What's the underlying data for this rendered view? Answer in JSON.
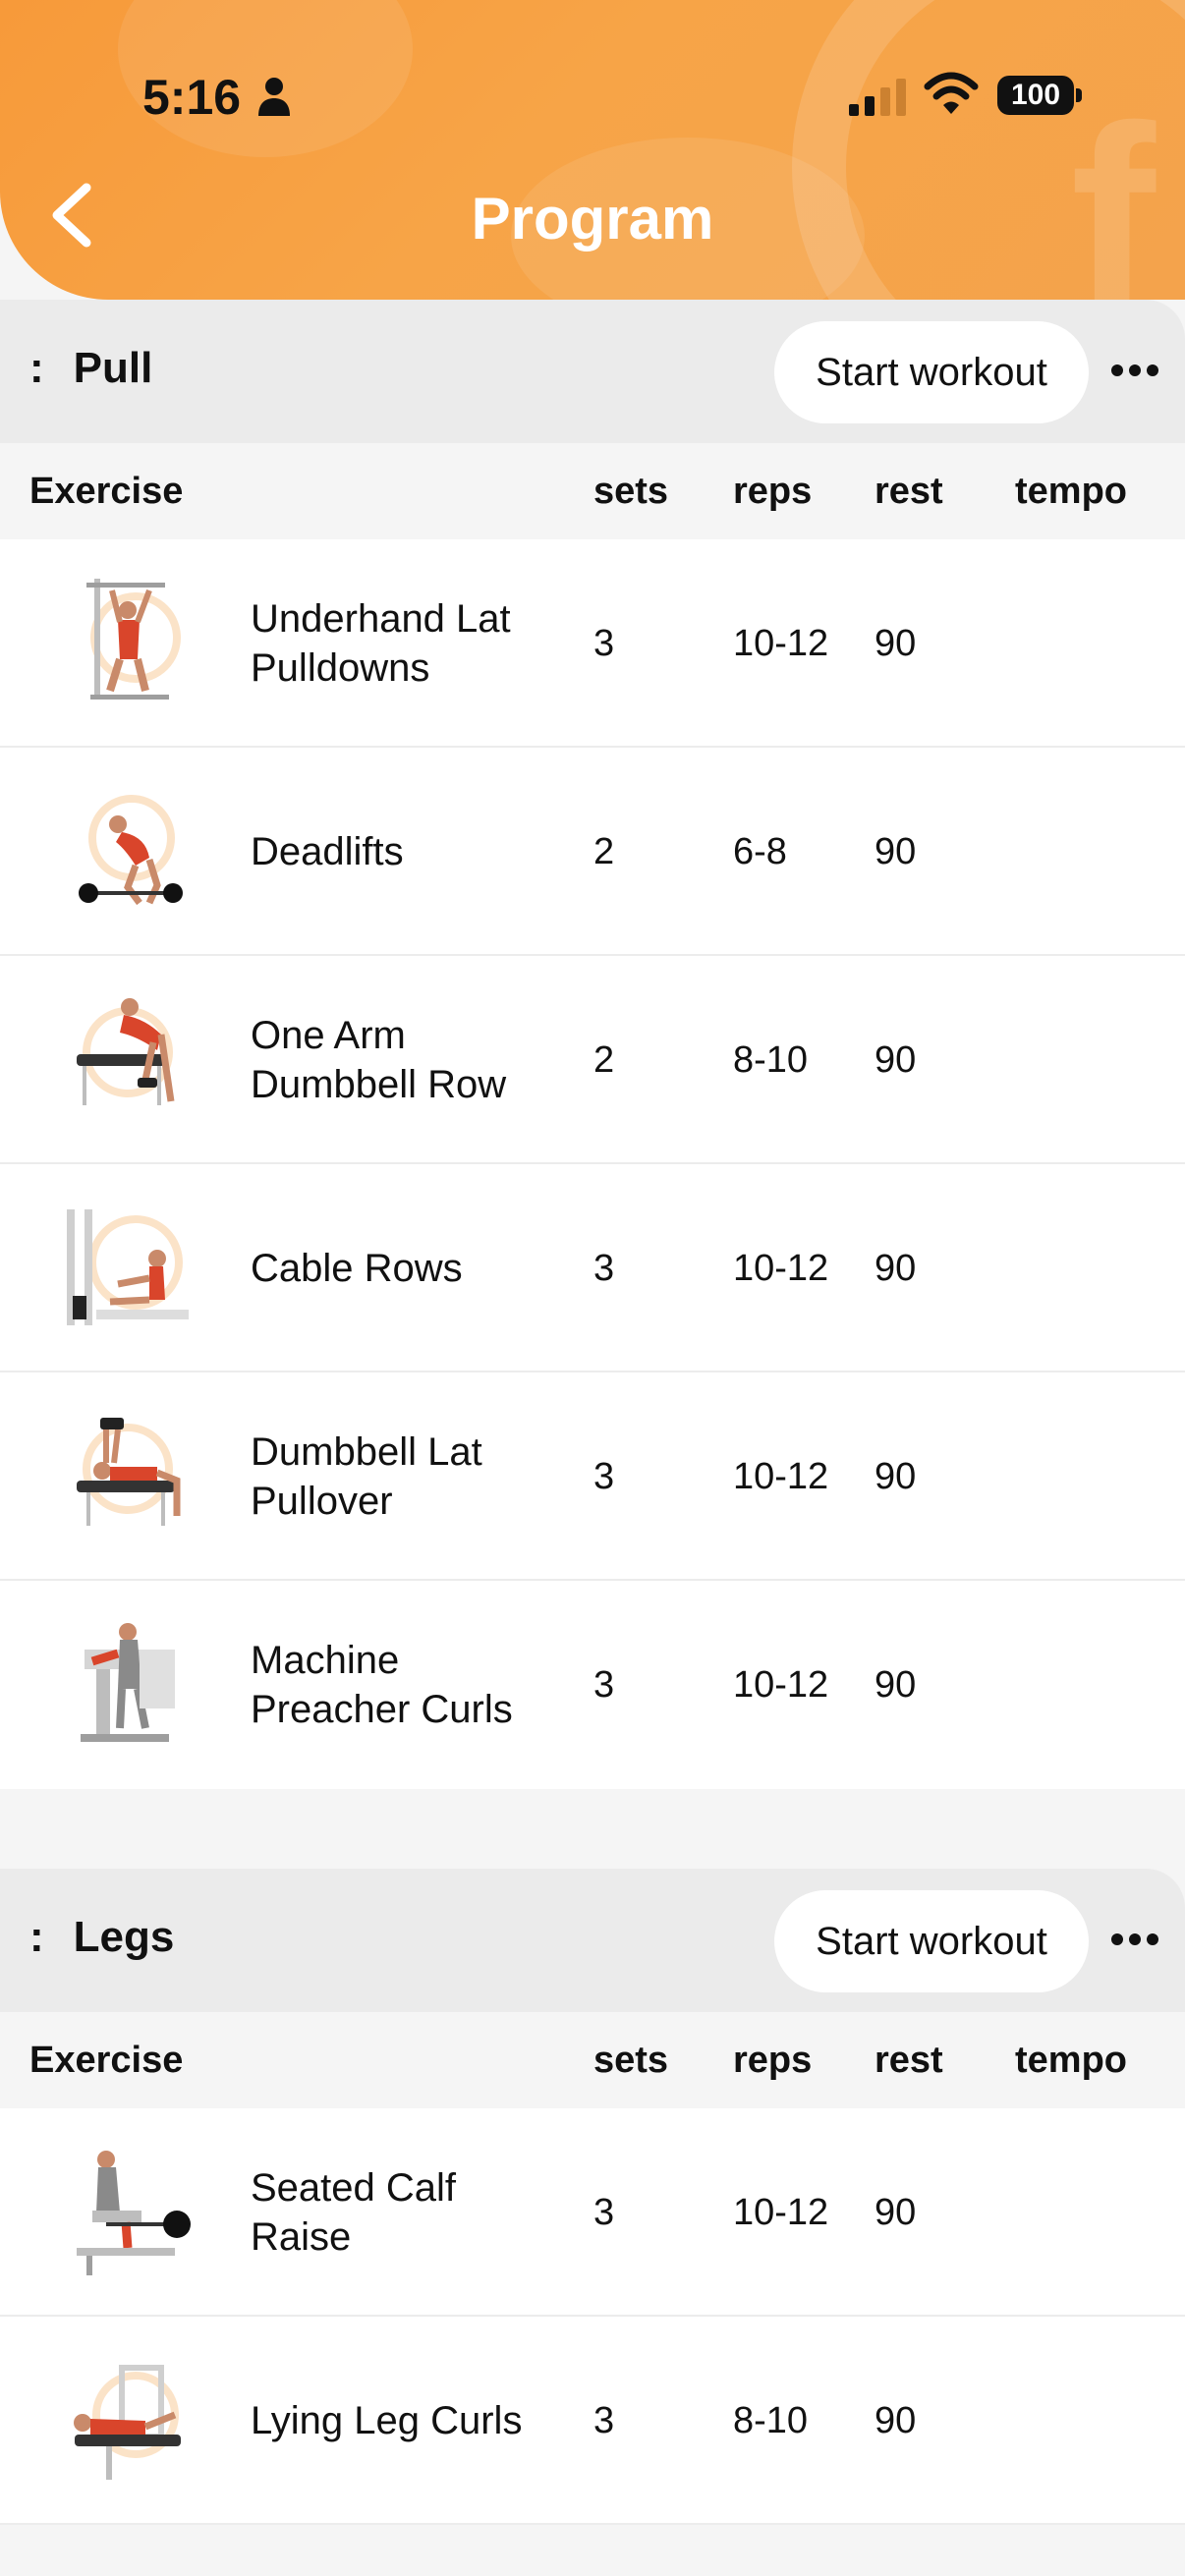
{
  "status_bar": {
    "time": "5:16",
    "battery": "100"
  },
  "header": {
    "title": "Program"
  },
  "columns": {
    "exercise": "Exercise",
    "sets": "sets",
    "reps": "reps",
    "rest": "rest",
    "tempo": "tempo"
  },
  "sections": [
    {
      "prefix": ":",
      "name": "Pull",
      "start_label": "Start workout",
      "exercises": [
        {
          "name": "Underhand Lat Pulldowns",
          "sets": "3",
          "reps": "10-12",
          "rest": "90",
          "tempo": ""
        },
        {
          "name": "Deadlifts",
          "sets": "2",
          "reps": "6-8",
          "rest": "90",
          "tempo": ""
        },
        {
          "name": "One Arm Dumbbell Row",
          "sets": "2",
          "reps": "8-10",
          "rest": "90",
          "tempo": ""
        },
        {
          "name": "Cable Rows",
          "sets": "3",
          "reps": "10-12",
          "rest": "90",
          "tempo": ""
        },
        {
          "name": "Dumbbell Lat Pullover",
          "sets": "3",
          "reps": "10-12",
          "rest": "90",
          "tempo": ""
        },
        {
          "name": "Machine Preacher Curls",
          "sets": "3",
          "reps": "10-12",
          "rest": "90",
          "tempo": ""
        }
      ]
    },
    {
      "prefix": ":",
      "name": "Legs",
      "start_label": "Start workout",
      "exercises": [
        {
          "name": "Seated Calf Raise",
          "sets": "3",
          "reps": "10-12",
          "rest": "90",
          "tempo": ""
        },
        {
          "name": "Lying Leg Curls",
          "sets": "3",
          "reps": "8-10",
          "rest": "90",
          "tempo": ""
        }
      ]
    }
  ],
  "colors": {
    "brand_orange": "#f7a043",
    "muscle_highlight": "#d9452b",
    "section_bar": "#ebebeb"
  }
}
